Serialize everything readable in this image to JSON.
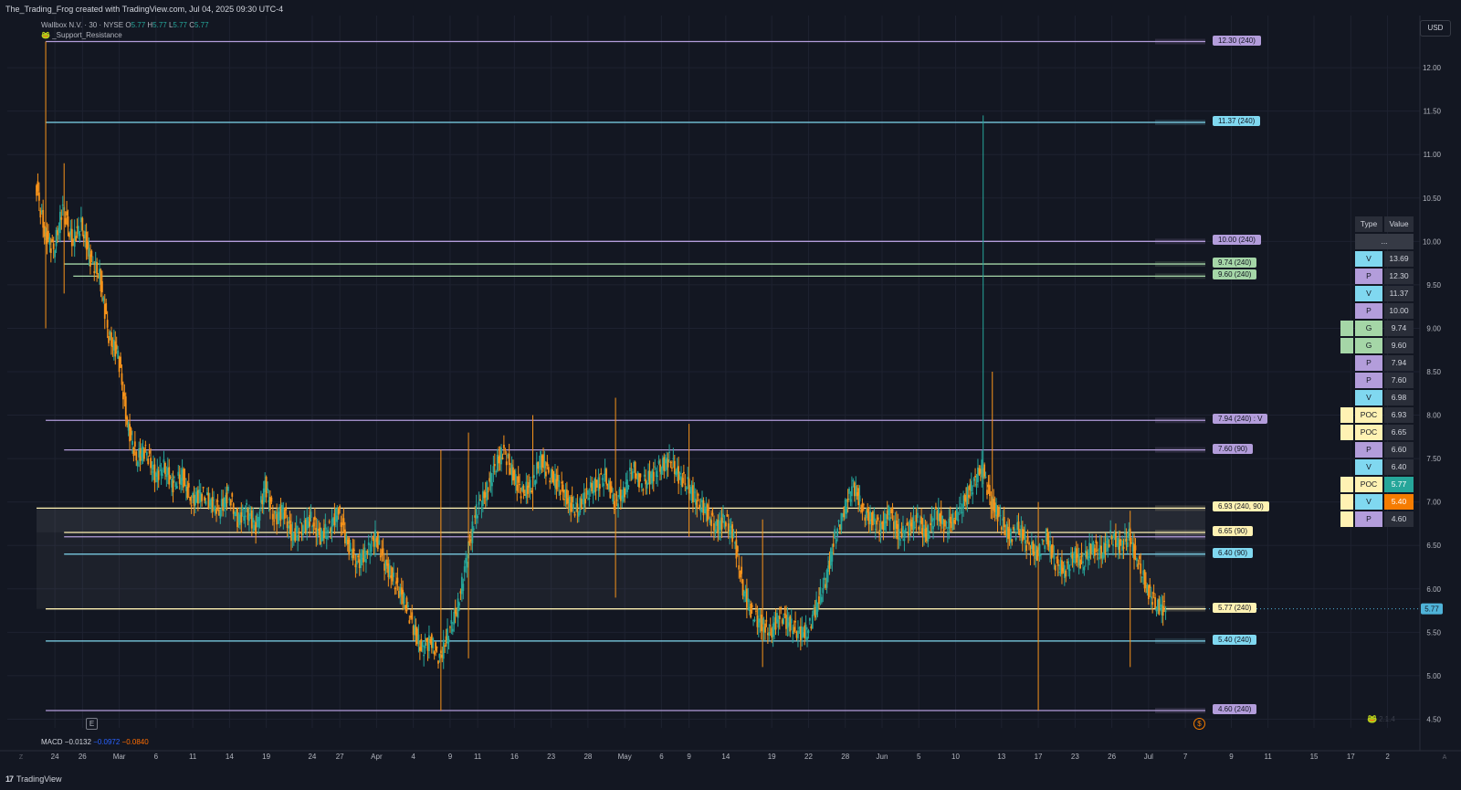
{
  "header": {
    "caption": "The_Trading_Frog created with TradingView.com, Jul 04, 2025 09:30 UTC-4"
  },
  "legend": {
    "symbol": "Wallbox N.V. · 30 · NYSE",
    "ohlc": [
      {
        "k": "O",
        "v": "5.77"
      },
      {
        "k": "H",
        "v": "5.77"
      },
      {
        "k": "L",
        "v": "5.77"
      },
      {
        "k": "C",
        "v": "5.77"
      }
    ],
    "indicator": "_Support_Resistance",
    "indicator_icon": "frog-icon"
  },
  "currency_button": "USD",
  "colors": {
    "background": "#131722",
    "grid": "#1e2230",
    "up_candle": "#26a69a",
    "down_candle": "#f7931a",
    "level_purple": "#b39ddb",
    "level_blue": "#80d8f0",
    "level_green": "#a5d6a7",
    "level_yellow": "#fff2b3",
    "last_price": "#4fb3d9"
  },
  "chart_data": {
    "type": "candlestick",
    "symbol": "Wallbox N.V.",
    "interval": "30",
    "exchange": "NYSE",
    "y_range": [
      4.4,
      12.6
    ],
    "y_ticks": [
      "12.00",
      "11.50",
      "11.00",
      "10.50",
      "10.00",
      "9.50",
      "9.00",
      "8.50",
      "8.00",
      "7.50",
      "7.00",
      "6.50",
      "6.00",
      "5.50",
      "5.00",
      "4.50"
    ],
    "x_range": [
      0,
      154
    ],
    "x_ticks": [
      {
        "label": "24",
        "x": 2
      },
      {
        "label": "26",
        "x": 5
      },
      {
        "label": "Mar",
        "x": 9
      },
      {
        "label": "6",
        "x": 13
      },
      {
        "label": "11",
        "x": 17
      },
      {
        "label": "14",
        "x": 21
      },
      {
        "label": "19",
        "x": 25
      },
      {
        "label": "24",
        "x": 30
      },
      {
        "label": "27",
        "x": 33
      },
      {
        "label": "Apr",
        "x": 37
      },
      {
        "label": "4",
        "x": 41
      },
      {
        "label": "9",
        "x": 45
      },
      {
        "label": "11",
        "x": 48
      },
      {
        "label": "16",
        "x": 52
      },
      {
        "label": "23",
        "x": 56
      },
      {
        "label": "28",
        "x": 60
      },
      {
        "label": "May",
        "x": 64
      },
      {
        "label": "6",
        "x": 68
      },
      {
        "label": "9",
        "x": 71
      },
      {
        "label": "14",
        "x": 75
      },
      {
        "label": "19",
        "x": 80
      },
      {
        "label": "22",
        "x": 84
      },
      {
        "label": "28",
        "x": 88
      },
      {
        "label": "Jun",
        "x": 92
      },
      {
        "label": "5",
        "x": 96
      },
      {
        "label": "10",
        "x": 100
      },
      {
        "label": "13",
        "x": 105
      },
      {
        "label": "17",
        "x": 109
      },
      {
        "label": "23",
        "x": 113
      },
      {
        "label": "26",
        "x": 117
      },
      {
        "label": "Jul",
        "x": 121
      },
      {
        "label": "7",
        "x": 125
      },
      {
        "label": "9",
        "x": 130
      },
      {
        "label": "11",
        "x": 134
      },
      {
        "label": "15",
        "x": 139
      },
      {
        "label": "17",
        "x": 143
      },
      {
        "label": "2",
        "x": 147
      }
    ],
    "last_price": 5.77,
    "last_price_label": "5.77",
    "price_path": [
      [
        0,
        10.7
      ],
      [
        1,
        10.1
      ],
      [
        2,
        9.9
      ],
      [
        3,
        10.4
      ],
      [
        4,
        10.0
      ],
      [
        5,
        10.2
      ],
      [
        6,
        9.8
      ],
      [
        7,
        9.6
      ],
      [
        8,
        8.9
      ],
      [
        9,
        8.7
      ],
      [
        10,
        7.9
      ],
      [
        11,
        7.5
      ],
      [
        12,
        7.6
      ],
      [
        13,
        7.3
      ],
      [
        14,
        7.4
      ],
      [
        15,
        7.2
      ],
      [
        16,
        7.3
      ],
      [
        17,
        7.0
      ],
      [
        18,
        7.1
      ],
      [
        19,
        7.0
      ],
      [
        20,
        6.9
      ],
      [
        21,
        7.1
      ],
      [
        22,
        6.8
      ],
      [
        23,
        6.9
      ],
      [
        24,
        6.7
      ],
      [
        25,
        7.2
      ],
      [
        26,
        6.8
      ],
      [
        27,
        6.9
      ],
      [
        28,
        6.6
      ],
      [
        29,
        6.7
      ],
      [
        30,
        6.8
      ],
      [
        31,
        6.6
      ],
      [
        32,
        6.7
      ],
      [
        33,
        6.9
      ],
      [
        34,
        6.5
      ],
      [
        35,
        6.3
      ],
      [
        36,
        6.4
      ],
      [
        37,
        6.6
      ],
      [
        38,
        6.3
      ],
      [
        39,
        6.1
      ],
      [
        40,
        5.9
      ],
      [
        41,
        5.6
      ],
      [
        42,
        5.3
      ],
      [
        43,
        5.4
      ],
      [
        44,
        5.2
      ],
      [
        45,
        5.5
      ],
      [
        46,
        5.8
      ],
      [
        47,
        6.4
      ],
      [
        48,
        6.9
      ],
      [
        49,
        7.1
      ],
      [
        50,
        7.4
      ],
      [
        51,
        7.6
      ],
      [
        52,
        7.3
      ],
      [
        53,
        7.1
      ],
      [
        54,
        7.2
      ],
      [
        55,
        7.5
      ],
      [
        56,
        7.3
      ],
      [
        57,
        7.2
      ],
      [
        58,
        7.0
      ],
      [
        59,
        6.9
      ],
      [
        60,
        7.1
      ],
      [
        61,
        7.2
      ],
      [
        62,
        7.3
      ],
      [
        63,
        7.0
      ],
      [
        64,
        7.1
      ],
      [
        65,
        7.4
      ],
      [
        66,
        7.2
      ],
      [
        67,
        7.3
      ],
      [
        68,
        7.4
      ],
      [
        69,
        7.5
      ],
      [
        70,
        7.3
      ],
      [
        71,
        7.2
      ],
      [
        72,
        7.0
      ],
      [
        73,
        6.9
      ],
      [
        74,
        6.7
      ],
      [
        75,
        6.8
      ],
      [
        76,
        6.6
      ],
      [
        77,
        6.0
      ],
      [
        78,
        5.7
      ],
      [
        79,
        5.6
      ],
      [
        80,
        5.5
      ],
      [
        81,
        5.7
      ],
      [
        82,
        5.6
      ],
      [
        83,
        5.5
      ],
      [
        84,
        5.5
      ],
      [
        85,
        5.8
      ],
      [
        86,
        6.1
      ],
      [
        87,
        6.6
      ],
      [
        88,
        6.9
      ],
      [
        89,
        7.2
      ],
      [
        90,
        6.9
      ],
      [
        91,
        6.8
      ],
      [
        92,
        6.7
      ],
      [
        93,
        6.9
      ],
      [
        94,
        6.6
      ],
      [
        95,
        6.7
      ],
      [
        96,
        6.8
      ],
      [
        97,
        6.6
      ],
      [
        98,
        6.9
      ],
      [
        99,
        6.7
      ],
      [
        100,
        6.8
      ],
      [
        101,
        7.0
      ],
      [
        102,
        7.2
      ],
      [
        103,
        7.4
      ],
      [
        104,
        7.0
      ],
      [
        105,
        6.8
      ],
      [
        106,
        6.6
      ],
      [
        107,
        6.7
      ],
      [
        108,
        6.5
      ],
      [
        109,
        6.4
      ],
      [
        110,
        6.6
      ],
      [
        111,
        6.3
      ],
      [
        112,
        6.2
      ],
      [
        113,
        6.4
      ],
      [
        114,
        6.3
      ],
      [
        115,
        6.5
      ],
      [
        116,
        6.4
      ],
      [
        117,
        6.6
      ],
      [
        118,
        6.5
      ],
      [
        119,
        6.6
      ],
      [
        120,
        6.3
      ],
      [
        121,
        6.0
      ],
      [
        122,
        5.8
      ],
      [
        123,
        5.77
      ]
    ],
    "spikes": [
      [
        1,
        12.3,
        9.0
      ],
      [
        3,
        10.9,
        9.4
      ],
      [
        44,
        7.6,
        4.6
      ],
      [
        47,
        7.8,
        5.2
      ],
      [
        54,
        8.0,
        6.9
      ],
      [
        63,
        8.2,
        5.9
      ],
      [
        71,
        7.9,
        6.6
      ],
      [
        79,
        6.8,
        5.1
      ],
      [
        103,
        11.45,
        7.0
      ],
      [
        104,
        8.5,
        6.8
      ],
      [
        109,
        7.0,
        4.6
      ],
      [
        119,
        6.9,
        5.1
      ]
    ],
    "levels": [
      {
        "price": 12.3,
        "label": "12.30 (240)",
        "color": "#b39ddb",
        "x_start": 1
      },
      {
        "price": 11.37,
        "label": "11.37 (240)",
        "color": "#80d8f0",
        "x_start": 1
      },
      {
        "price": 10.0,
        "label": "10.00 (240)",
        "color": "#b39ddb",
        "x_start": 1
      },
      {
        "price": 9.74,
        "label": "9.74 (240)",
        "color": "#a5d6a7",
        "x_start": 3
      },
      {
        "price": 9.6,
        "label": "9.60 (240)",
        "color": "#a5d6a7",
        "x_start": 4
      },
      {
        "price": 7.94,
        "label": "7.94 (240) : V",
        "color": "#b39ddb",
        "x_start": 1
      },
      {
        "price": 7.6,
        "label": "7.60 (90)",
        "color": "#b39ddb",
        "x_start": 3
      },
      {
        "price": 6.93,
        "label": "6.93 (240, 90)",
        "color": "#fff2b3",
        "x_start": 0
      },
      {
        "price": 6.65,
        "label": "6.65 (90)",
        "color": "#fff2b3",
        "x_start": 3
      },
      {
        "price": 6.6,
        "label": "",
        "color": "#b39ddb",
        "x_start": 3
      },
      {
        "price": 6.4,
        "label": "6.40 (90)",
        "color": "#80d8f0",
        "x_start": 3
      },
      {
        "price": 5.77,
        "label": "5.77 (240)",
        "color": "#fff2b3",
        "x_start": 1
      },
      {
        "price": 5.4,
        "label": "5.40 (240)",
        "color": "#80d8f0",
        "x_start": 1
      },
      {
        "price": 4.6,
        "label": "4.60 (240)",
        "color": "#b39ddb",
        "x_start": 1
      }
    ]
  },
  "table": {
    "headers": [
      "Type",
      "Value"
    ],
    "placeholder": "...",
    "rows": [
      {
        "type": "V",
        "value": "13.69",
        "type_color": "#80d8f0",
        "value_color": "#2a2e39",
        "marker": false
      },
      {
        "type": "P",
        "value": "12.30",
        "type_color": "#b39ddb",
        "value_color": "#2a2e39",
        "marker": false
      },
      {
        "type": "V",
        "value": "11.37",
        "type_color": "#80d8f0",
        "value_color": "#2a2e39",
        "marker": false
      },
      {
        "type": "P",
        "value": "10.00",
        "type_color": "#b39ddb",
        "value_color": "#2a2e39",
        "marker": false
      },
      {
        "type": "G",
        "value": "9.74",
        "type_color": "#a5d6a7",
        "value_color": "#2a2e39",
        "marker": true,
        "marker_color": "#a5d6a7"
      },
      {
        "type": "G",
        "value": "9.60",
        "type_color": "#a5d6a7",
        "value_color": "#2a2e39",
        "marker": true,
        "marker_color": "#a5d6a7"
      },
      {
        "type": "P",
        "value": "7.94",
        "type_color": "#b39ddb",
        "value_color": "#2a2e39",
        "marker": false
      },
      {
        "type": "P",
        "value": "7.60",
        "type_color": "#b39ddb",
        "value_color": "#2a2e39",
        "marker": false
      },
      {
        "type": "V",
        "value": "6.98",
        "type_color": "#80d8f0",
        "value_color": "#2a2e39",
        "marker": false
      },
      {
        "type": "POC",
        "value": "6.93",
        "type_color": "#fff2b3",
        "value_color": "#2a2e39",
        "marker": true,
        "marker_color": "#fff2b3"
      },
      {
        "type": "POC",
        "value": "6.65",
        "type_color": "#fff2b3",
        "value_color": "#2a2e39",
        "marker": true,
        "marker_color": "#fff2b3"
      },
      {
        "type": "P",
        "value": "6.60",
        "type_color": "#b39ddb",
        "value_color": "#2a2e39",
        "marker": false
      },
      {
        "type": "V",
        "value": "6.40",
        "type_color": "#80d8f0",
        "value_color": "#2a2e39",
        "marker": false
      },
      {
        "type": "POC",
        "value": "5.77",
        "type_color": "#fff2b3",
        "value_color": "#26a69a",
        "marker": true,
        "marker_color": "#fff2b3"
      },
      {
        "type": "V",
        "value": "5.40",
        "type_color": "#80d8f0",
        "value_color": "#f57c00",
        "marker": true,
        "marker_color": "#fff2b3"
      },
      {
        "type": "P",
        "value": "4.60",
        "type_color": "#b39ddb",
        "value_color": "#2a2e39",
        "marker": true,
        "marker_color": "#fff2b3"
      }
    ]
  },
  "macd": {
    "label": "MACD",
    "values": [
      {
        "v": "−0.0132",
        "color": "#d1d4dc"
      },
      {
        "v": "−0.0972",
        "color": "#2962ff"
      },
      {
        "v": "−0.0840",
        "color": "#ff6d00"
      }
    ]
  },
  "events": {
    "earnings_label": "E",
    "dividend_label": "$"
  },
  "axis_corner": {
    "left": "Z",
    "right": "A"
  },
  "watermark": "2.1.4",
  "footer": {
    "brand": "TradingView",
    "logo": "tradingview-logo-icon"
  }
}
